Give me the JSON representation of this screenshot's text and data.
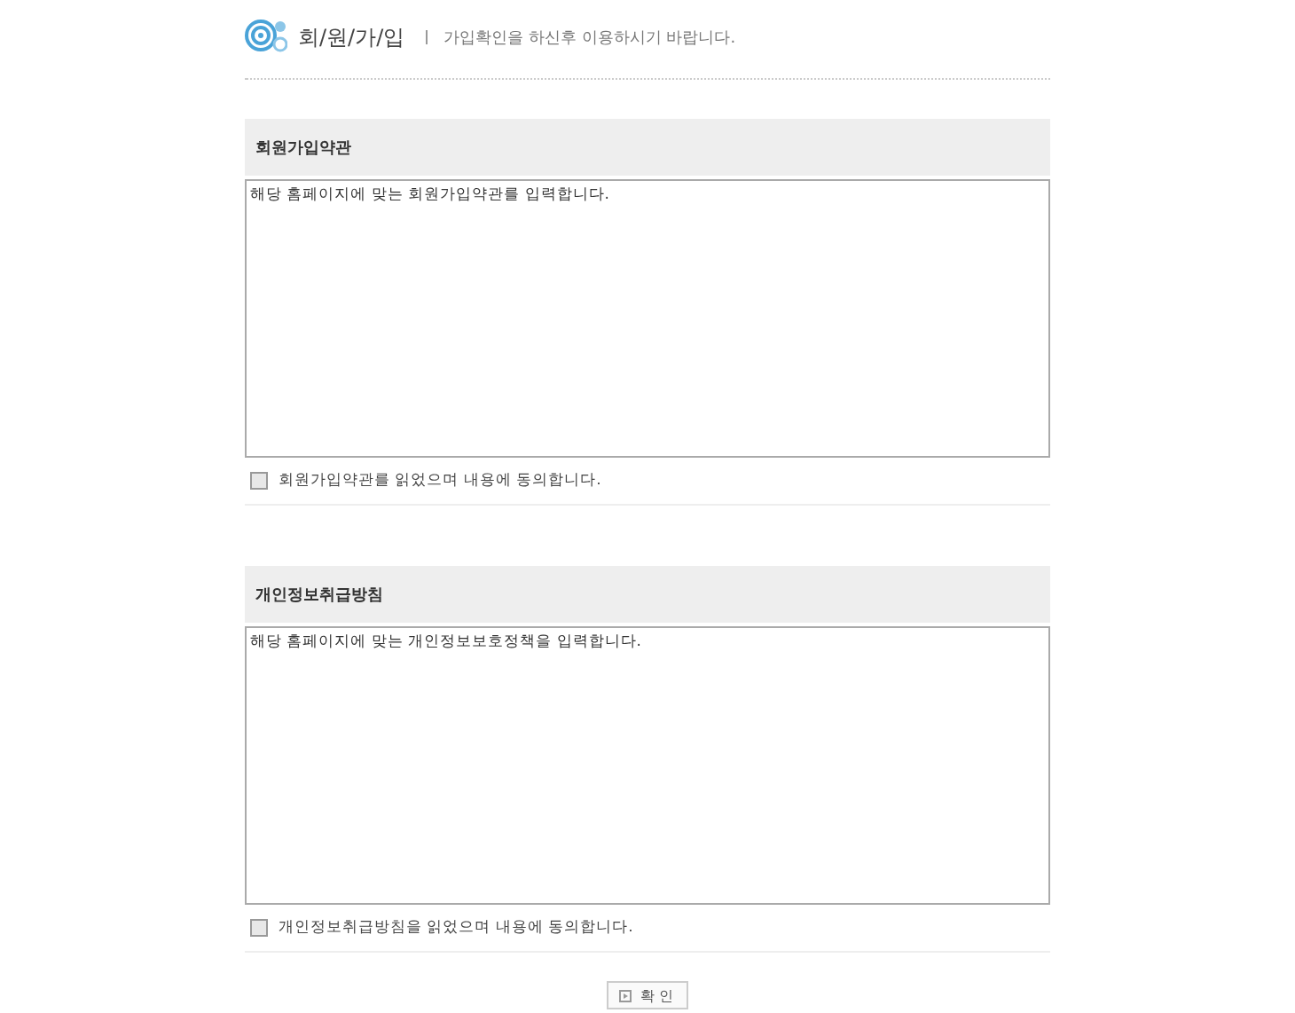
{
  "header": {
    "title": "회/원/가/입",
    "subtitle": "가입확인을 하신후 이용하시기 바랍니다."
  },
  "sections": [
    {
      "title": "회원가입약관",
      "content": "해당 홈페이지에 맞는 회원가입약관를 입력합니다.",
      "agree_label": "회원가입약관를 읽었으며 내용에 동의합니다.",
      "checked": false
    },
    {
      "title": "개인정보취급방침",
      "content": "해당 홈페이지에 맞는 개인정보보호정책을 입력합니다.",
      "agree_label": "개인정보취급방침을 읽었으며 내용에 동의합니다.",
      "checked": false
    }
  ],
  "confirm_button": "확 인"
}
